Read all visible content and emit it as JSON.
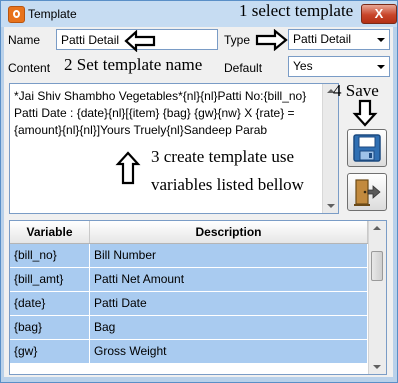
{
  "window": {
    "title": "Template",
    "close_label": "X"
  },
  "form": {
    "name_label": "Name",
    "name_value": "Patti Detail",
    "type_label": "Type",
    "type_value": "Patti Detail",
    "content_label": "Content",
    "default_label": "Default",
    "default_value": "Yes",
    "template_text": "*Jai Shiv Shambho Vegetables*{nl}{nl}Patti No:{bill_no} Patti Date : {date}{nl}[{item} {bag} {gw}{nw} X {rate} = {amount}{nl}{nl}]Yours Truely{nl}Sandeep Parab"
  },
  "annotations": {
    "step1": "1 select template",
    "step2": "2 Set template name",
    "step3_line1": "3 create template use",
    "step3_line2": "variables listed bellow",
    "step4": "4 Save"
  },
  "variables_table": {
    "headers": [
      "Variable",
      "Description"
    ],
    "rows": [
      {
        "variable": "{bill_no}",
        "description": "Bill Number"
      },
      {
        "variable": "{bill_amt}",
        "description": "Patti Net Amount"
      },
      {
        "variable": "{date}",
        "description": "Patti Date"
      },
      {
        "variable": "{bag}",
        "description": "Bag"
      },
      {
        "variable": "{gw}",
        "description": "Gross Weight"
      }
    ]
  },
  "icons": {
    "app": "blogger-b-icon",
    "save": "floppy-disk-icon",
    "exit": "door-exit-icon"
  },
  "colors": {
    "row_background": "#a9cbf0",
    "title_bar": "#c6dcf2",
    "close_button": "#c8452a"
  }
}
